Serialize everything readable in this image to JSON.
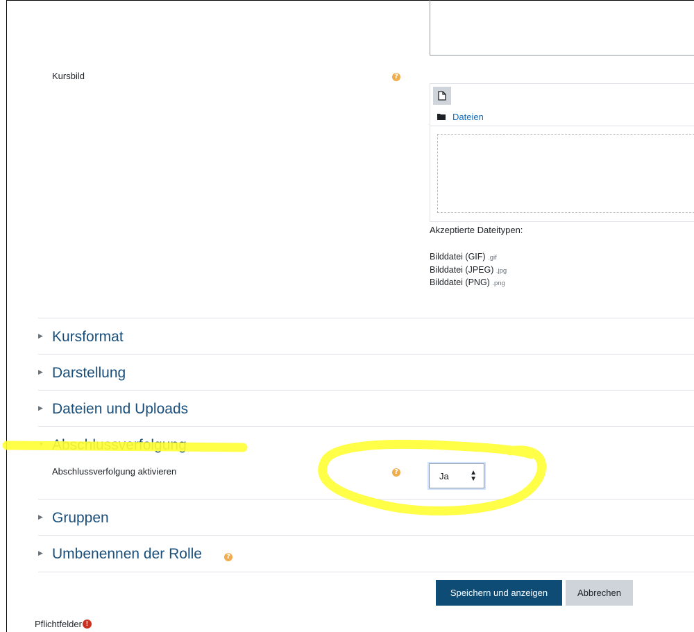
{
  "course_image": {
    "label": "Kursbild",
    "help_icon": "question-circle-icon",
    "filepicker": {
      "add_icon": "file-icon",
      "folder_icon": "folder-icon",
      "path_label": "Dateien"
    },
    "accepted_types_heading": "Akzeptierte Dateitypen:",
    "accepted_types": [
      {
        "name": "Bilddatei (GIF)",
        "ext": ".gif"
      },
      {
        "name": "Bilddatei (JPEG)",
        "ext": ".jpg"
      },
      {
        "name": "Bilddatei (PNG)",
        "ext": ".png"
      }
    ]
  },
  "sections": [
    {
      "title": "Kursformat",
      "expanded": false
    },
    {
      "title": "Darstellung",
      "expanded": false
    },
    {
      "title": "Dateien und Uploads",
      "expanded": false
    },
    {
      "title": "Abschlussverfolgung",
      "expanded": true
    },
    {
      "title": "Gruppen",
      "expanded": false
    },
    {
      "title": "Umbenennen der Rolle",
      "expanded": false
    }
  ],
  "completion": {
    "field_label": "Abschlussverfolgung aktivieren",
    "select_value": "Ja"
  },
  "buttons": {
    "save": "Speichern und anzeigen",
    "cancel": "Abbrechen"
  },
  "required_note": "Pflichtfelder",
  "colors": {
    "highlight": "#ffff33",
    "link": "#0f6cbf",
    "section_title": "#1a4e7a",
    "primary_button": "#0f4c75",
    "help_icon": "#f0ad4e",
    "required_icon": "#ca3120"
  }
}
